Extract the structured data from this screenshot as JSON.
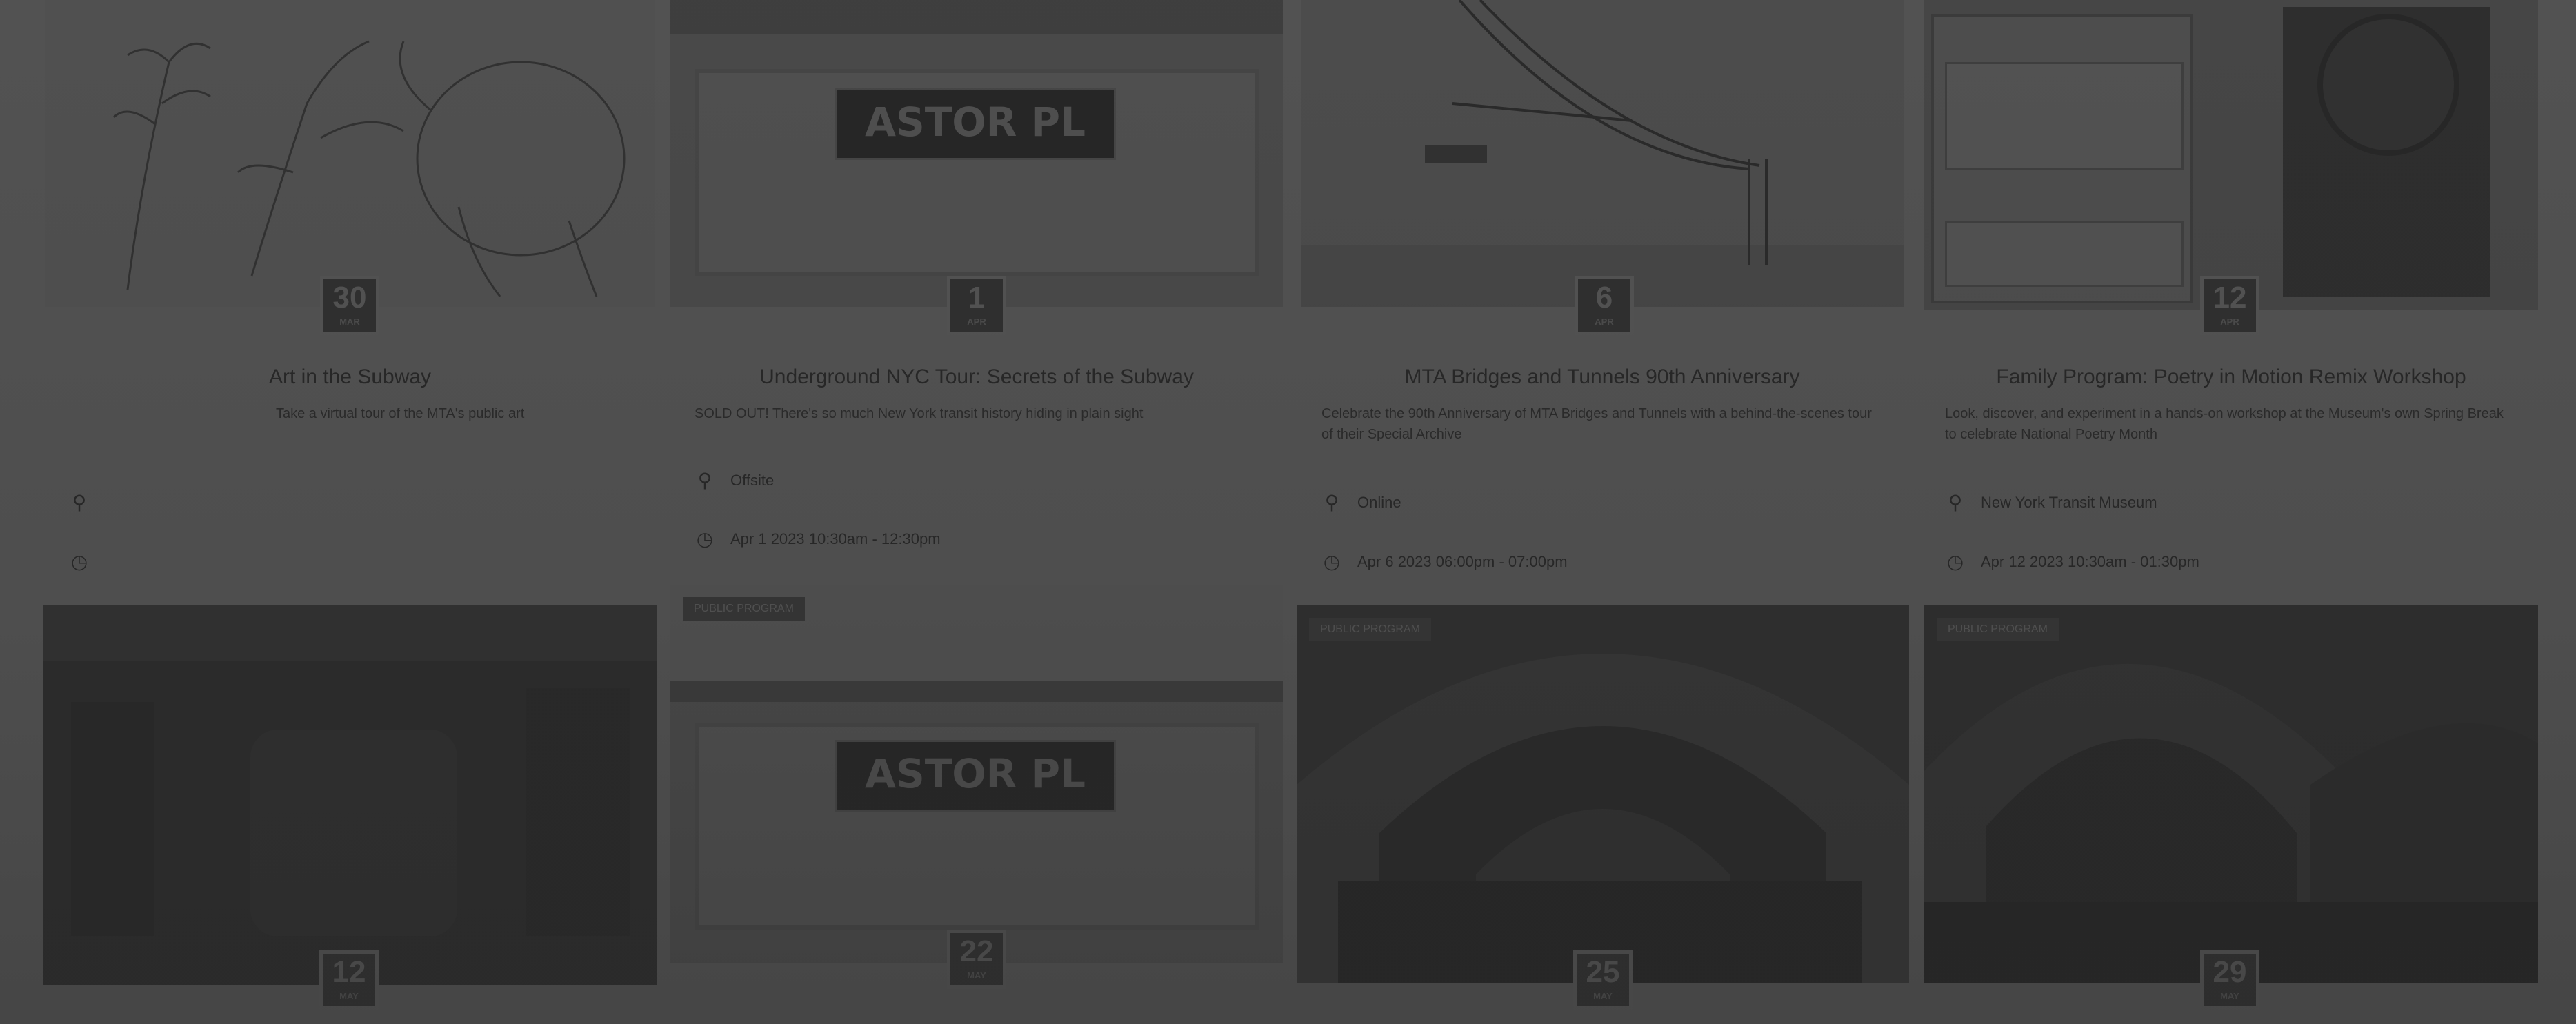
{
  "cards": [
    {
      "title": "Art in the Subway",
      "description": "Take a virtual tour of the MTA's public art",
      "location": "",
      "datetime": "",
      "day": "30",
      "month": "MAR"
    },
    {
      "title": "Underground NYC Tour: Secrets of the Subway",
      "description": "SOLD OUT! There's so much New York transit history hiding in plain sight",
      "location": "Offsite",
      "datetime": "Apr 1 2023 10:30am - 12:30pm",
      "day": "1",
      "month": "APR",
      "sign_text": "ASTOR PL"
    },
    {
      "title": "MTA Bridges and Tunnels 90th Anniversary",
      "description": "Celebrate the 90th Anniversary of MTA Bridges and Tunnels with a behind-the-scenes tour of their Special Archive",
      "location": "Online",
      "datetime": "Apr 6 2023 06:00pm - 07:00pm",
      "day": "6",
      "month": "APR"
    },
    {
      "title": "Family Program: Poetry in Motion Remix Workshop",
      "description": "Look, discover, and experiment in a hands-on workshop at the Museum's own Spring Break to celebrate National Poetry Month",
      "location": "New York Transit Museum",
      "datetime": "Apr 12 2023 10:30am - 01:30pm",
      "day": "12",
      "month": "APR"
    },
    {
      "badge": "",
      "day": "12",
      "month": "MAY"
    },
    {
      "badge": "PUBLIC PROGRAM",
      "day": "22",
      "month": "MAY",
      "sign_text": "ASTOR PL"
    },
    {
      "badge": "PUBLIC PROGRAM",
      "day": "25",
      "month": "MAY"
    },
    {
      "badge": "PUBLIC PROGRAM",
      "day": "29",
      "month": "MAY"
    }
  ]
}
